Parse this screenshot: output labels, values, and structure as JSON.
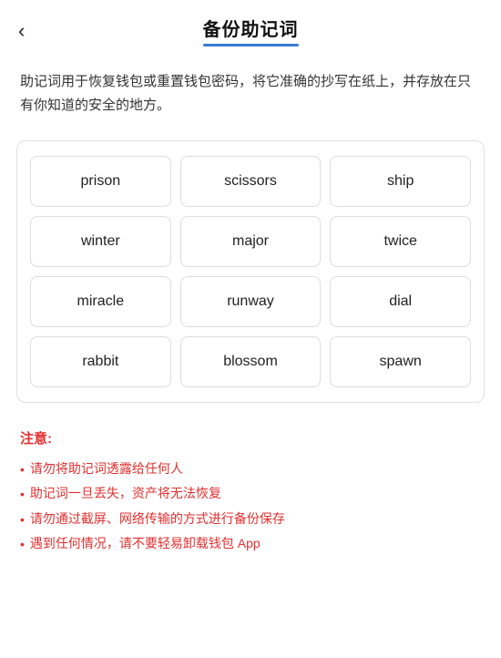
{
  "header": {
    "back_label": "‹",
    "title": "备份助记词"
  },
  "description": "助记词用于恢复钱包或重置钱包密码，将它准确的抄写在纸上，并存放在只有你知道的安全的地方。",
  "mnemonic": {
    "words": [
      "prison",
      "scissors",
      "ship",
      "winter",
      "major",
      "twice",
      "miracle",
      "runway",
      "dial",
      "rabbit",
      "blossom",
      "spawn"
    ]
  },
  "notice": {
    "title": "注意:",
    "items": [
      "请勿将助记词透露给任何人",
      "助记词一旦丢失，资产将无法恢复",
      "请勿通过截屏、网络传输的方式进行备份保存",
      "遇到任何情况，请不要轻易卸载钱包 App"
    ]
  }
}
